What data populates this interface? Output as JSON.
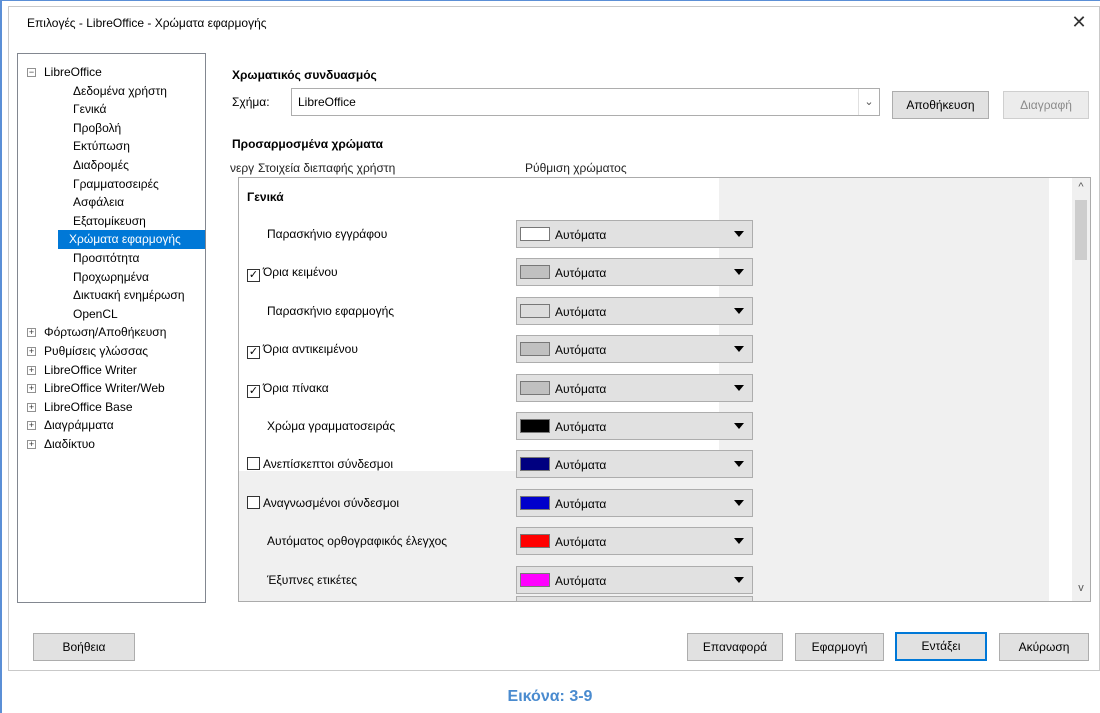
{
  "dialog": {
    "title": "Επιλογές - LibreOffice - Χρώματα εφαρμογής",
    "close_glyph": "✕"
  },
  "tree": {
    "items": [
      {
        "label": "LibreOffice",
        "level": 0,
        "expander": "−"
      },
      {
        "label": "Δεδομένα χρήστη",
        "level": 1
      },
      {
        "label": "Γενικά",
        "level": 1
      },
      {
        "label": "Προβολή",
        "level": 1
      },
      {
        "label": "Εκτύπωση",
        "level": 1
      },
      {
        "label": "Διαδρομές",
        "level": 1
      },
      {
        "label": "Γραμματοσειρές",
        "level": 1
      },
      {
        "label": "Ασφάλεια",
        "level": 1
      },
      {
        "label": "Εξατομίκευση",
        "level": 1
      },
      {
        "label": "Χρώματα εφαρμογής",
        "level": 1,
        "selected": true
      },
      {
        "label": "Προσιτότητα",
        "level": 1
      },
      {
        "label": "Προχωρημένα",
        "level": 1
      },
      {
        "label": "Δικτυακή ενημέρωση",
        "level": 1
      },
      {
        "label": "OpenCL",
        "level": 1
      },
      {
        "label": "Φόρτωση/Αποθήκευση",
        "level": 0,
        "expander": "+"
      },
      {
        "label": "Ρυθμίσεις γλώσσας",
        "level": 0,
        "expander": "+"
      },
      {
        "label": "LibreOffice Writer",
        "level": 0,
        "expander": "+"
      },
      {
        "label": "LibreOffice Writer/Web",
        "level": 0,
        "expander": "+"
      },
      {
        "label": "LibreOffice Base",
        "level": 0,
        "expander": "+"
      },
      {
        "label": "Διαγράμματα",
        "level": 0,
        "expander": "+"
      },
      {
        "label": "Διαδίκτυο",
        "level": 0,
        "expander": "+"
      }
    ]
  },
  "scheme": {
    "section_title": "Χρωματικός συνδυασμός",
    "label": "Σχήμα:",
    "value": "LibreOffice",
    "save_button": "Αποθήκευση",
    "delete_button": "Διαγραφή"
  },
  "custom": {
    "section_title": "Προσαρμοσμένα χρώματα",
    "col_on": "νεργ",
    "col_ui": "Στοιχεία διεπαφής χρήστη",
    "col_color": "Ρύθμιση χρώματος",
    "group": "Γενικά",
    "rows": [
      {
        "label": "Παρασκήνιο εγγράφου",
        "checkbox": false,
        "checked": false,
        "color": "#ffffff",
        "value": "Αυτόματα"
      },
      {
        "label": "Όρια κειμένου",
        "checkbox": true,
        "checked": true,
        "color": "#c0c0c0",
        "value": "Αυτόματα"
      },
      {
        "label": "Παρασκήνιο εφαρμογής",
        "checkbox": false,
        "checked": false,
        "color": "#dddddd",
        "value": "Αυτόματα"
      },
      {
        "label": "Όρια αντικειμένου",
        "checkbox": true,
        "checked": true,
        "color": "#c0c0c0",
        "value": "Αυτόματα"
      },
      {
        "label": "Όρια πίνακα",
        "checkbox": true,
        "checked": true,
        "color": "#c0c0c0",
        "value": "Αυτόματα"
      },
      {
        "label": "Χρώμα γραμματοσειράς",
        "checkbox": false,
        "checked": false,
        "color": "#000000",
        "value": "Αυτόματα"
      },
      {
        "label": "Ανεπίσκεπτοι σύνδεσμοι",
        "checkbox": true,
        "checked": false,
        "color": "#000080",
        "value": "Αυτόματα"
      },
      {
        "label": "Αναγνωσμένοι σύνδεσμοι",
        "checkbox": true,
        "checked": false,
        "color": "#0000cc",
        "value": "Αυτόματα"
      },
      {
        "label": "Αυτόματος ορθογραφικός έλεγχος",
        "checkbox": false,
        "checked": false,
        "color": "#ff0000",
        "value": "Αυτόματα"
      },
      {
        "label": "Έξυπνες ετικέτες",
        "checkbox": false,
        "checked": false,
        "color": "#ff00ff",
        "value": "Αυτόματα"
      }
    ]
  },
  "buttons": {
    "help": "Βοήθεια",
    "reset": "Επαναφορά",
    "apply": "Εφαρμογή",
    "ok": "Εντάξει",
    "cancel": "Ακύρωση"
  },
  "caption": "Εικόνα: 3-9"
}
